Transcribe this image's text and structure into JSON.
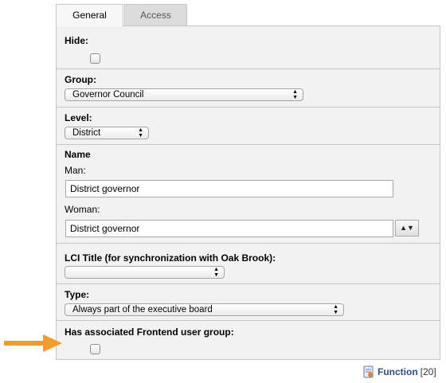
{
  "tabs": [
    {
      "label": "General",
      "active": true
    },
    {
      "label": "Access",
      "active": false
    }
  ],
  "fields": {
    "hide": {
      "label": "Hide:",
      "checked": false
    },
    "group": {
      "label": "Group:",
      "value": "Governor Council"
    },
    "level": {
      "label": "Level:",
      "value": "District"
    },
    "name": {
      "label": "Name",
      "man_label": "Man:",
      "man_value": "District governor",
      "woman_label": "Woman:",
      "woman_value": "District governor",
      "toggle_label": "▲▼"
    },
    "lci_title": {
      "label": "LCI Title (for synchronization with Oak Brook):",
      "value": ""
    },
    "type": {
      "label": "Type:",
      "value": "Always part of the executive board"
    },
    "frontend_group": {
      "label": "Has associated Frontend user group:",
      "checked": false
    }
  },
  "footer": {
    "icon": "function-record-icon",
    "label": "Function",
    "count": "[20]"
  },
  "colors": {
    "arrow": "#f39c2a",
    "link": "#2a4f8e",
    "panel_bg": "#f2f2f2",
    "border": "#c6c6c6"
  }
}
